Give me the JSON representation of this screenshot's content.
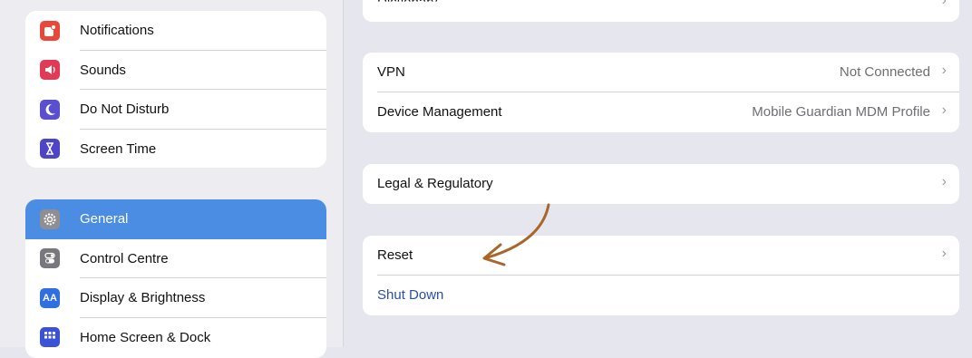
{
  "sidebar": {
    "top_group": [
      {
        "label": "Notifications",
        "icon": "notifications-icon",
        "color": "#e8483a"
      },
      {
        "label": "Sounds",
        "icon": "speaker-icon",
        "color": "#e13a56"
      },
      {
        "label": "Do Not Disturb",
        "icon": "moon-icon",
        "color": "#5a4fd1"
      },
      {
        "label": "Screen Time",
        "icon": "hourglass-icon",
        "color": "#4d44c8"
      }
    ],
    "bottom_group": [
      {
        "label": "General",
        "icon": "gear-icon",
        "color": "#8e8e93",
        "selected": true
      },
      {
        "label": "Control Centre",
        "icon": "toggles-icon",
        "color": "#77777d"
      },
      {
        "label": "Display & Brightness",
        "icon": "aa-icon",
        "color": "#2f6fe0"
      },
      {
        "label": "Home Screen & Dock",
        "icon": "grid-icon",
        "color": "#3a52d6"
      }
    ]
  },
  "main": {
    "partial_row": {
      "title": "Dictionary"
    },
    "card1": [
      {
        "title": "VPN",
        "value": "Not Connected"
      },
      {
        "title": "Device Management",
        "value": "Mobile Guardian MDM Profile"
      }
    ],
    "card2": [
      {
        "title": "Legal & Regulatory",
        "value": ""
      }
    ],
    "card3": [
      {
        "title": "Reset",
        "value": ""
      },
      {
        "title": "Shut Down",
        "value": ""
      }
    ],
    "chevron": "›",
    "aa_glyph": "AA",
    "annotation_color": "#a9652a"
  }
}
